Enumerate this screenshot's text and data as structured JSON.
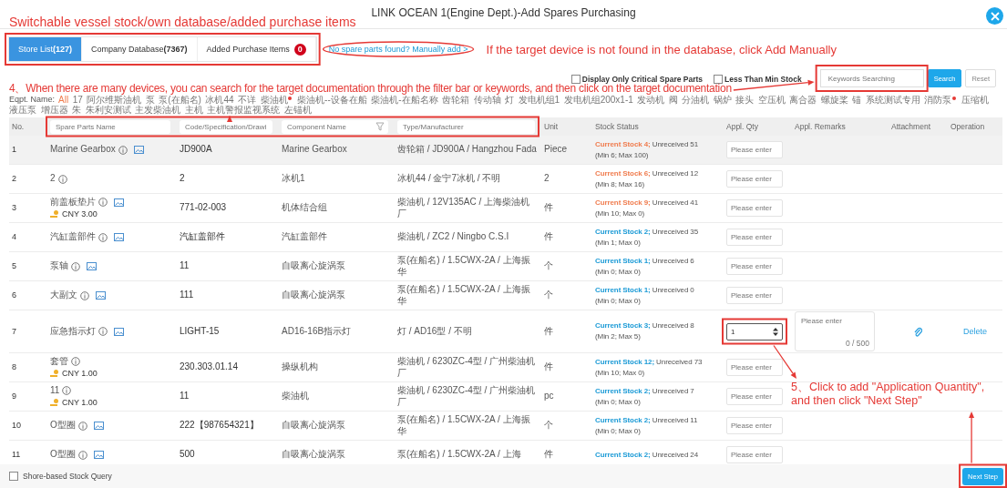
{
  "window": {
    "title": "LINK OCEAN 1(Engine Dept.)-Add Spares Purchasing"
  },
  "tabs": [
    {
      "label": "Store List",
      "count": "(127)",
      "selected": true
    },
    {
      "label": "Company Database",
      "count": "(7367)",
      "selected": false
    },
    {
      "label": "Added Purchase Items",
      "badge": "0",
      "selected": false
    }
  ],
  "manual_add_link": "No spare parts found? Manually add >",
  "filters": {
    "checkboxes": [
      {
        "label": "Display Only Critical Spare Parts",
        "checked": false
      },
      {
        "label": "Less Than Min Stock",
        "checked": false
      }
    ],
    "search": {
      "placeholder": "Keywords Searching"
    },
    "buttons": [
      {
        "label": "Search",
        "kind": "primary"
      },
      {
        "label": "Reset",
        "kind": "plain"
      }
    ]
  },
  "equipment_filter": {
    "label": "Eqpt. Name:",
    "options": [
      {
        "label": "All",
        "selected": true,
        "flagged": false
      },
      {
        "label": "17",
        "selected": false,
        "flagged": false
      },
      {
        "label": "阿尔维斯油机",
        "selected": false,
        "flagged": false
      },
      {
        "label": "泵",
        "selected": false,
        "flagged": false
      },
      {
        "label": "泵(在船名)",
        "selected": false,
        "flagged": false
      },
      {
        "label": "冰机44",
        "selected": false,
        "flagged": false
      },
      {
        "label": "不详",
        "selected": false,
        "flagged": false
      },
      {
        "label": "柴油机",
        "selected": false,
        "flagged": true
      },
      {
        "label": "柴油机--设备在船",
        "selected": false,
        "flagged": false
      },
      {
        "label": "柴油机-在船名称",
        "selected": false,
        "flagged": false
      },
      {
        "label": "齿轮箱",
        "selected": false,
        "flagged": false
      },
      {
        "label": "传动轴",
        "selected": false,
        "flagged": false
      },
      {
        "label": "灯",
        "selected": false,
        "flagged": false
      },
      {
        "label": "发电机组1",
        "selected": false,
        "flagged": false
      },
      {
        "label": "发电机组200x1-1",
        "selected": false,
        "flagged": false
      },
      {
        "label": "发动机",
        "selected": false,
        "flagged": false
      },
      {
        "label": "阀",
        "selected": false,
        "flagged": false
      },
      {
        "label": "分油机",
        "selected": false,
        "flagged": false
      },
      {
        "label": "锅炉",
        "selected": false,
        "flagged": false
      },
      {
        "label": "接头",
        "selected": false,
        "flagged": false
      },
      {
        "label": "空压机",
        "selected": false,
        "flagged": false
      },
      {
        "label": "离合器",
        "selected": false,
        "flagged": false
      },
      {
        "label": "螺旋桨",
        "selected": false,
        "flagged": false
      },
      {
        "label": "锚",
        "selected": false,
        "flagged": false
      },
      {
        "label": "系统测试专用",
        "selected": false,
        "flagged": false
      },
      {
        "label": "消防泵",
        "selected": false,
        "flagged": true
      },
      {
        "label": "压缩机",
        "selected": false,
        "flagged": false
      },
      {
        "label": "液压泵",
        "selected": false,
        "flagged": false
      },
      {
        "label": "增压器",
        "selected": false,
        "flagged": false
      },
      {
        "label": "朱",
        "selected": false,
        "flagged": false
      },
      {
        "label": "朱利安测试",
        "selected": false,
        "flagged": false
      },
      {
        "label": "主发柴油机",
        "selected": false,
        "flagged": false
      },
      {
        "label": "主机",
        "selected": false,
        "flagged": false
      },
      {
        "label": "主机警报监视系统",
        "selected": false,
        "flagged": false
      },
      {
        "label": "左锚机",
        "selected": false,
        "flagged": false
      }
    ]
  },
  "table": {
    "columns": [
      {
        "kind": "label",
        "label": "No."
      },
      {
        "kind": "filter",
        "placeholder": "Spare Parts Name"
      },
      {
        "kind": "filter",
        "placeholder": "Code/Specification/Drawi"
      },
      {
        "kind": "filter-menu",
        "placeholder": "Component Name"
      },
      {
        "kind": "filter",
        "placeholder": "Type/Manufacturer"
      },
      {
        "kind": "label",
        "label": "Unit"
      },
      {
        "kind": "label",
        "label": "Stock Status"
      },
      {
        "kind": "label",
        "label": "Appl. Qty"
      },
      {
        "kind": "label",
        "label": "Appl. Remarks"
      },
      {
        "kind": "label",
        "label": "Attachment"
      },
      {
        "kind": "label",
        "label": "Operation"
      }
    ],
    "rows": [
      {
        "no": "1",
        "name": "Marine Gearbox",
        "has_image": true,
        "code": "JD900A",
        "component": "Marine Gearbox",
        "type": "齿轮箱 / JD900A / Hangzhou Fada",
        "unit": "Piece",
        "stock": {
          "current": "Current Stock 4;",
          "unreceived": "Unreceived 51",
          "range": "(Min 6; Max 100)",
          "below_min": true
        },
        "qty": {
          "placeholder": "Please enter"
        },
        "highlighted": true
      },
      {
        "no": "2",
        "name": "2",
        "has_image": false,
        "code": "2",
        "component": "冰机1",
        "type": "冰机44 / 金宁7冰机 / 不明",
        "unit": "2",
        "stock": {
          "current": "Current Stock 6;",
          "unreceived": "Unreceived 12",
          "range": "(Min 8; Max 16)",
          "below_min": true
        },
        "qty": {
          "placeholder": "Please enter"
        },
        "highlighted": false
      },
      {
        "no": "3",
        "name": "前盖板垫片",
        "has_image": true,
        "price": "CNY 3.00",
        "code": "771-02-003",
        "component": "机体结合组",
        "type": "柴油机 / 12V135AC / 上海柴油机厂",
        "unit": "件",
        "stock": {
          "current": "Current Stock 9;",
          "unreceived": "Unreceived 41",
          "range": "(Min 10; Max 0)",
          "below_min": true
        },
        "qty": {
          "placeholder": "Please enter"
        },
        "highlighted": false
      },
      {
        "no": "4",
        "name": "汽缸盖部件",
        "has_image": true,
        "code": "汽缸盖部件",
        "component": "汽缸盖部件",
        "type": "柴油机 / ZC2 / Ningbo C.S.I",
        "unit": "件",
        "stock": {
          "current": "Current Stock 2;",
          "unreceived": "Unreceived 35",
          "range": "(Min 1; Max 0)",
          "below_min": false
        },
        "qty": {
          "placeholder": "Please enter"
        },
        "highlighted": false
      },
      {
        "no": "5",
        "name": "泵轴",
        "has_image": true,
        "code": "11",
        "component": "自吸离心旋涡泵",
        "type": "泵(在船名) / 1.5CWX-2A / 上海振华",
        "unit": "个",
        "stock": {
          "current": "Current Stock 1;",
          "unreceived": "Unreceived 6",
          "range": "(Min 0; Max 0)",
          "below_min": false
        },
        "qty": {
          "placeholder": "Please enter"
        },
        "highlighted": false
      },
      {
        "no": "6",
        "name": "大副文",
        "has_image": true,
        "code": "111",
        "component": "自吸离心旋涡泵",
        "type": "泵(在船名) / 1.5CWX-2A / 上海振华",
        "unit": "个",
        "stock": {
          "current": "Current Stock 1;",
          "unreceived": "Unreceived 0",
          "range": "(Min 0; Max 0)",
          "below_min": false
        },
        "qty": {
          "placeholder": "Please enter"
        },
        "highlighted": false
      },
      {
        "no": "7",
        "name": "应急指示灯",
        "has_image": true,
        "code": "LIGHT-15",
        "component": "AD16-16B指示灯",
        "type": "灯 / AD16型 / 不明",
        "unit": "件",
        "stock": {
          "current": "Current Stock 3;",
          "unreceived": "Unreceived 8",
          "range": "(Min 2; Max 5)",
          "below_min": false
        },
        "qty": {
          "value": "1",
          "focused": true
        },
        "remarks": {
          "placeholder": "Please enter",
          "counter": "0 / 500"
        },
        "attachment": true,
        "operation": "Delete",
        "highlighted": false
      },
      {
        "no": "8",
        "name": "套管",
        "has_image": false,
        "price": "CNY 1.00",
        "code": "230.303.01.14",
        "component": "操纵机构",
        "type": "柴油机 / 6230ZC-4型 / 广州柴油机厂",
        "unit": "件",
        "stock": {
          "current": "Current Stock 12;",
          "unreceived": "Unreceived 73",
          "range": "(Min 10; Max 0)",
          "below_min": false
        },
        "qty": {
          "placeholder": "Please enter"
        },
        "highlighted": false
      },
      {
        "no": "9",
        "name": "11",
        "has_image": false,
        "price": "CNY 1.00",
        "code": "11",
        "component": "柴油机",
        "type": "柴油机 / 6230ZC-4型 / 广州柴油机厂",
        "unit": "pc",
        "stock": {
          "current": "Current Stock 2;",
          "unreceived": "Unreceived 7",
          "range": "(Min 0; Max 0)",
          "below_min": false
        },
        "qty": {
          "placeholder": "Please enter"
        },
        "highlighted": false
      },
      {
        "no": "10",
        "name": "O型圈",
        "has_image": true,
        "code": "222【987654321】",
        "component": "自吸离心旋涡泵",
        "type": "泵(在船名) / 1.5CWX-2A / 上海振华",
        "unit": "个",
        "stock": {
          "current": "Current Stock 2;",
          "unreceived": "Unreceived 11",
          "range": "(Min 0; Max 0)",
          "below_min": false
        },
        "qty": {
          "placeholder": "Please enter"
        },
        "highlighted": false
      },
      {
        "no": "11",
        "name": "O型圈",
        "has_image": true,
        "code": "500",
        "component": "自吸离心旋涡泵",
        "type": "泵(在船名) / 1.5CWX-2A / 上海",
        "unit": "件",
        "stock": {
          "current": "Current Stock 2;",
          "unreceived": "Unreceived 24",
          "below_min": false
        },
        "qty": {
          "placeholder": "Please enter"
        },
        "highlighted": false
      }
    ]
  },
  "footer": {
    "checkbox": {
      "label": "Shore-based Stock Query",
      "checked": false
    },
    "next_button": "Next Step"
  },
  "annotations": {
    "tabs_note": "Switchable vessel stock/own database/added purchase items",
    "manual_note": "If the target device is not found in the database, click Add Manually",
    "search_note": "4、When there are many devices, you can search for the target documentation through the filter bar or keywords, and then click on the target documentation",
    "quantity_note": "5、Click to add \"Application Quantity\", and then click \"Next Step\""
  }
}
